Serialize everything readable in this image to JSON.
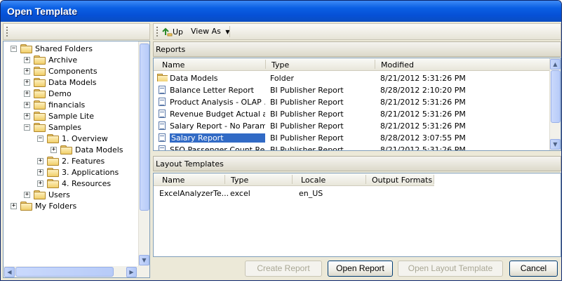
{
  "window": {
    "title": "Open Template"
  },
  "toolbar": {
    "up_label": "Up",
    "view_as_label": "View As"
  },
  "tree": [
    {
      "label": "Shared Folders",
      "toggle": "−",
      "level": 0
    },
    {
      "label": "Archive",
      "toggle": "+",
      "level": 1
    },
    {
      "label": "Components",
      "toggle": "+",
      "level": 1
    },
    {
      "label": "Data Models",
      "toggle": "+",
      "level": 1
    },
    {
      "label": "Demo",
      "toggle": "+",
      "level": 1
    },
    {
      "label": "financials",
      "toggle": "+",
      "level": 1
    },
    {
      "label": "Sample Lite",
      "toggle": "+",
      "level": 1
    },
    {
      "label": "Samples",
      "toggle": "−",
      "level": 1
    },
    {
      "label": "1. Overview",
      "toggle": "−",
      "level": 2
    },
    {
      "label": "Data Models",
      "toggle": "+",
      "level": 3
    },
    {
      "label": "2. Features",
      "toggle": "+",
      "level": 2
    },
    {
      "label": "3. Applications",
      "toggle": "+",
      "level": 2
    },
    {
      "label": "4. Resources",
      "toggle": "+",
      "level": 2
    },
    {
      "label": "Users",
      "toggle": "+",
      "level": 1
    },
    {
      "label": "My Folders",
      "toggle": "+",
      "level": 0
    }
  ],
  "reports": {
    "title": "Reports",
    "columns": [
      "Name",
      "Type",
      "Modified"
    ],
    "rows": [
      {
        "name": "Data Models",
        "type": "Folder",
        "modified": "8/21/2012 5:31:26 PM",
        "icon": "folder-icon"
      },
      {
        "name": "Balance Letter Report",
        "type": "BI Publisher Report",
        "modified": "8/28/2012 2:10:20 PM",
        "icon": "report-icon"
      },
      {
        "name": "Product Analysis - OLAP ...",
        "type": "BI Publisher Report",
        "modified": "8/21/2012 5:31:26 PM",
        "icon": "report-icon"
      },
      {
        "name": "Revenue Budget Actual a...",
        "type": "BI Publisher Report",
        "modified": "8/21/2012 5:31:26 PM",
        "icon": "report-icon"
      },
      {
        "name": "Salary Report - No Param...",
        "type": "BI Publisher Report",
        "modified": "8/21/2012 5:31:26 PM",
        "icon": "report-icon"
      },
      {
        "name": "Salary Report",
        "type": "BI Publisher Report",
        "modified": "8/28/2012 3:07:55 PM",
        "icon": "report-icon",
        "selected": true
      },
      {
        "name": "SFO Passenger Count Re...",
        "type": "BI Publisher Report",
        "modified": "8/21/2012 5:31:26 PM",
        "icon": "report-icon"
      }
    ]
  },
  "layouts": {
    "title": "Layout Templates",
    "columns": [
      "Name",
      "Type",
      "Locale",
      "Output Formats"
    ],
    "rows": [
      {
        "name": "ExcelAnalyzerTe...",
        "type": "excel",
        "locale": "en_US",
        "formats": ""
      }
    ]
  },
  "buttons": {
    "create_report": "Create Report",
    "open_report": "Open Report",
    "open_layout": "Open Layout Template",
    "cancel": "Cancel"
  }
}
